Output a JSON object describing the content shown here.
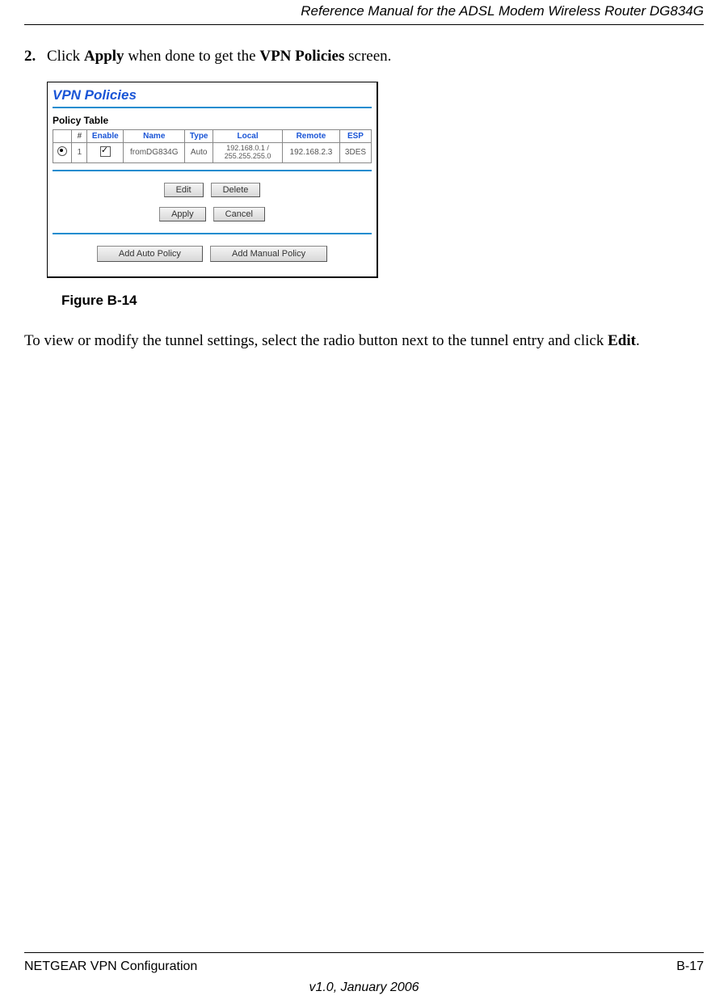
{
  "header": {
    "title": "Reference Manual for the ADSL Modem Wireless Router DG834G"
  },
  "step": {
    "number": "2.",
    "pre": "Click ",
    "b1": "Apply",
    "mid": " when done to get the ",
    "b2": "VPN Policies",
    "post": " screen."
  },
  "screenshot": {
    "title": "VPN Policies",
    "subtitle": "Policy Table",
    "headers": {
      "radio": "",
      "num": "#",
      "enable": "Enable",
      "name": "Name",
      "type": "Type",
      "local": "Local",
      "remote": "Remote",
      "esp": "ESP"
    },
    "row": {
      "num": "1",
      "name": "fromDG834G",
      "type": "Auto",
      "local": "192.168.0.1 / 255.255.255.0",
      "remote": "192.168.2.3",
      "esp": "3DES"
    },
    "buttons": {
      "edit": "Edit",
      "delete": "Delete",
      "apply": "Apply",
      "cancel": "Cancel",
      "add_auto": "Add Auto Policy",
      "add_manual": "Add Manual Policy"
    }
  },
  "figure_caption": "Figure B-14",
  "paragraph": {
    "pre": "To view or modify the tunnel settings, select the radio button next to the tunnel entry and click ",
    "b": "Edit",
    "post": "."
  },
  "footer": {
    "left": "NETGEAR VPN Configuration",
    "right": "B-17",
    "center": "v1.0, January 2006"
  }
}
